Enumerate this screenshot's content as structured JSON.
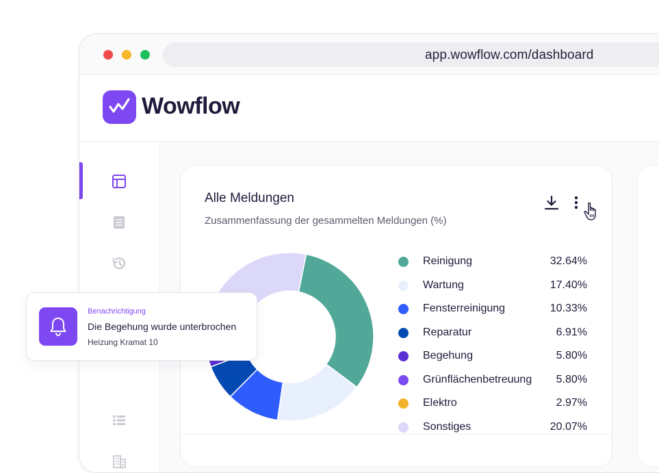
{
  "browser": {
    "url": "app.wowflow.com/dashboard"
  },
  "brand": {
    "name": "Wowflow",
    "color": "#7d47f2"
  },
  "sidebar": {
    "items": [
      {
        "icon": "layout-icon",
        "active": true
      },
      {
        "icon": "document-icon",
        "active": false
      },
      {
        "icon": "history-icon",
        "active": false
      },
      {
        "icon": "list-icon",
        "active": false
      },
      {
        "icon": "building-icon",
        "active": false
      }
    ]
  },
  "card": {
    "title": "Alle Meldungen",
    "subtitle": "Zusammenfassung der gesammelten Meldungen (%)"
  },
  "chart_data": {
    "type": "pie",
    "categories": [
      "Reinigung",
      "Wartung",
      "Fensterreinigung",
      "Reparatur",
      "Begehung",
      "Grünflächenbetreuung",
      "Elektro",
      "Sonstiges"
    ],
    "values": [
      32.64,
      17.4,
      10.33,
      6.91,
      5.8,
      5.8,
      2.97,
      20.07
    ],
    "value_labels": [
      "32.64%",
      "17.40%",
      "10.33%",
      "6.91%",
      "5.80%",
      "5.80%",
      "2.97%",
      "20.07%"
    ],
    "colors": [
      "#52a898",
      "#e9f0fd",
      "#2f5cfd",
      "#0549b3",
      "#5b2fd6",
      "#7a4af2",
      "#f2b22b",
      "#dcd8fa"
    ],
    "title": "Alle Meldungen",
    "subtitle": "Zusammenfassung der gesammelten Meldungen (%)",
    "legend": "right",
    "donut": true
  },
  "toast": {
    "label": "Benachrichtigung",
    "title": "Die Begehung wurde unterbrochen",
    "subtitle": "Heizung Kramat 10",
    "icon": "bell-icon"
  }
}
